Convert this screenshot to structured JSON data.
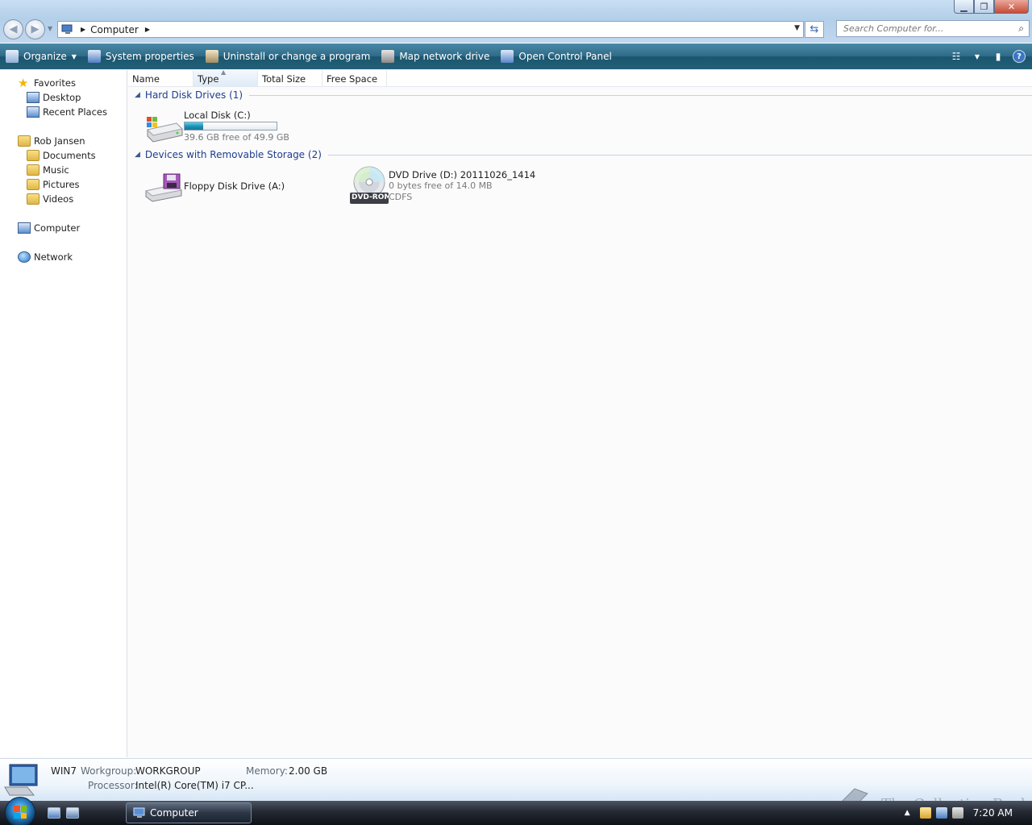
{
  "window": {
    "caption_buttons": [
      "minimize",
      "restore",
      "close"
    ]
  },
  "address": {
    "crumbs": [
      "Computer"
    ],
    "search_placeholder": "Search Computer for..."
  },
  "commands": [
    {
      "label": "Organize",
      "has_menu": true,
      "icon": "organize-icon"
    },
    {
      "label": "System properties",
      "icon": "system-properties-icon"
    },
    {
      "label": "Uninstall or change a program",
      "icon": "uninstall-icon"
    },
    {
      "label": "Map network drive",
      "icon": "map-drive-icon"
    },
    {
      "label": "Open Control Panel",
      "icon": "control-panel-icon"
    }
  ],
  "nav": {
    "favorites": "Favorites",
    "desktop": "Desktop",
    "recent": "Recent Places",
    "user": "Rob Jansen",
    "documents": "Documents",
    "music": "Music",
    "pictures": "Pictures",
    "videos": "Videos",
    "computer": "Computer",
    "network": "Network"
  },
  "columns": [
    "Name",
    "Type",
    "Total Size",
    "Free Space"
  ],
  "groups": {
    "hdd": "Hard Disk Drives (1)",
    "removable": "Devices with Removable Storage (2)"
  },
  "drives": {
    "c": {
      "label": "Local Disk (C:)",
      "sub": "39.6 GB free of 49.9 GB",
      "used_fraction": 0.206
    },
    "a": {
      "label": "Floppy Disk Drive (A:)"
    },
    "d": {
      "label": "DVD Drive (D:) 20111026_1414",
      "sub": "0 bytes free of 14.0 MB",
      "fs": "CDFS",
      "badge": "DVD-ROM"
    }
  },
  "details": {
    "name": "WIN7",
    "workgroup_key": "Workgroup:",
    "workgroup": "WORKGROUP",
    "memory_key": "Memory:",
    "memory": "2.00 GB",
    "processor_key": "Processor:",
    "processor": "Intel(R) Core(TM) i7 CP..."
  },
  "taskbar": {
    "task": "Computer",
    "clock": "7:20 AM"
  },
  "watermark": "The Collection Book"
}
